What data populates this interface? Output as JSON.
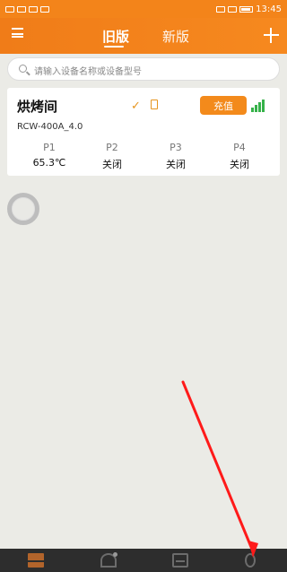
{
  "status_bar": {
    "left_icons": [
      "sim-icon",
      "wifi-icon",
      "message-icon",
      "cloud-icon"
    ],
    "time": "13:45"
  },
  "header": {
    "tabs": [
      {
        "label": "旧版",
        "active": true
      },
      {
        "label": "新版",
        "active": false
      }
    ]
  },
  "search": {
    "placeholder": "请输入设备名称或设备型号"
  },
  "device": {
    "title": "烘烤间",
    "model": "RCW-400A_4.0",
    "recharge_label": "充值",
    "ports": [
      {
        "name": "P1",
        "value": "65.3℃"
      },
      {
        "name": "P2",
        "value": "关闭"
      },
      {
        "name": "P3",
        "value": "关闭"
      },
      {
        "name": "P4",
        "value": "关闭"
      }
    ]
  },
  "colors": {
    "header": "#f3841a",
    "accent": "#f38a1b",
    "signal": "#36b24a",
    "background": "#ebebe6",
    "arrow": "#ff1a1a"
  }
}
